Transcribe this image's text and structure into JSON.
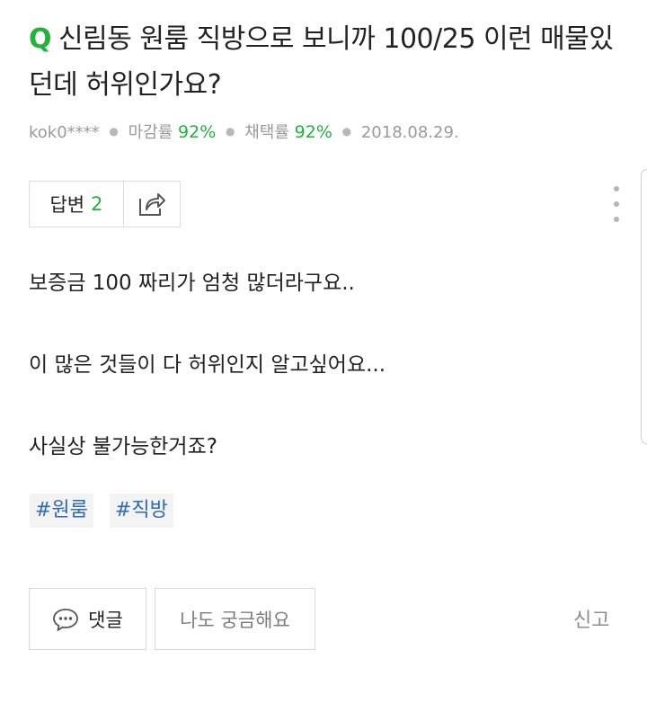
{
  "question": {
    "mark": "Q",
    "title": "신림동 원룸 직방으로 보니까 100/25 이런 매물있던데 허위인가요?"
  },
  "meta": {
    "author": "kok0****",
    "close_rate_label": "마감률",
    "close_rate_value": "92%",
    "adopt_rate_label": "채택률",
    "adopt_rate_value": "92%",
    "date": "2018.08.29."
  },
  "answers": {
    "label": "답변",
    "count": "2"
  },
  "body": {
    "line1": "보증금 100 짜리가 엄청 많더라구요..",
    "line2": "이 많은 것들이 다 허위인지 알고싶어요...",
    "line3": "사실상 불가능한거죠?"
  },
  "tags": [
    "#원룸",
    "#직방"
  ],
  "actions": {
    "comment_label": "댓글",
    "curious_label": "나도 궁금해요",
    "report_label": "신고"
  },
  "colors": {
    "accent_green": "#20b23b",
    "tag_blue": "#2f6bb0"
  },
  "icons": [
    "share-icon",
    "more-vertical-icon",
    "speech-bubble-icon"
  ]
}
